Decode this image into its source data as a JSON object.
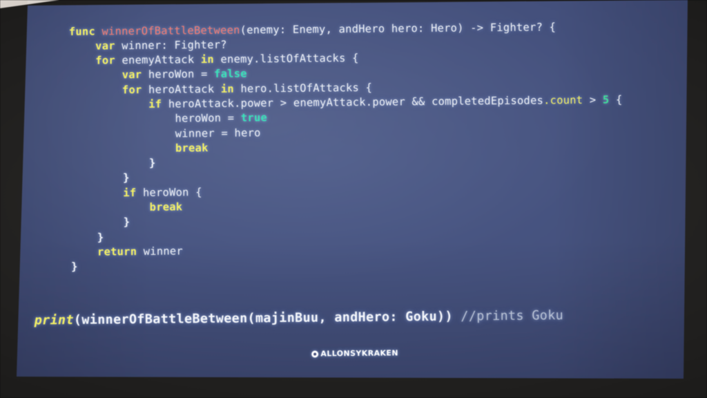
{
  "scene": {
    "type": "photo-of-projector-screen",
    "background_color": "#45507a",
    "bezel_color": "#201f1e",
    "wall_color": "#d2cbc3"
  },
  "code": {
    "language": "Swift",
    "lines": [
      [
        {
          "t": "    ",
          "c": "plain"
        },
        {
          "t": "func ",
          "c": "kw"
        },
        {
          "t": "winnerOfBattleBetween",
          "c": "fnname"
        },
        {
          "t": "(enemy: Enemy, andHero hero: Hero) -> Fighter? {",
          "c": "plain"
        }
      ],
      [
        {
          "t": "        ",
          "c": "plain"
        },
        {
          "t": "var ",
          "c": "kw"
        },
        {
          "t": "winner: Fighter?",
          "c": "plain"
        }
      ],
      [
        {
          "t": "        ",
          "c": "plain"
        },
        {
          "t": "for ",
          "c": "kw"
        },
        {
          "t": "enemyAttack ",
          "c": "plain"
        },
        {
          "t": "in ",
          "c": "kw"
        },
        {
          "t": "enemy.listOfAttacks {",
          "c": "plain"
        }
      ],
      [
        {
          "t": "            ",
          "c": "plain"
        },
        {
          "t": "var ",
          "c": "kw"
        },
        {
          "t": "heroWon = ",
          "c": "plain"
        },
        {
          "t": "false",
          "c": "lit"
        }
      ],
      [
        {
          "t": "            ",
          "c": "plain"
        },
        {
          "t": "for ",
          "c": "kw"
        },
        {
          "t": "heroAttack ",
          "c": "plain"
        },
        {
          "t": "in ",
          "c": "kw"
        },
        {
          "t": "hero.listOfAttacks {",
          "c": "plain"
        }
      ],
      [
        {
          "t": "                ",
          "c": "plain"
        },
        {
          "t": "if ",
          "c": "kw"
        },
        {
          "t": "heroAttack.power > enemyAttack.power && completedEpisodes",
          "c": "plain"
        },
        {
          "t": ".count",
          "c": "prop"
        },
        {
          "t": " > ",
          "c": "plain"
        },
        {
          "t": "5",
          "c": "num"
        },
        {
          "t": " {",
          "c": "plain"
        }
      ],
      [
        {
          "t": "                    ",
          "c": "plain"
        },
        {
          "t": "heroWon = ",
          "c": "plain"
        },
        {
          "t": "true",
          "c": "lit"
        }
      ],
      [
        {
          "t": "                    ",
          "c": "plain"
        },
        {
          "t": "winner = hero",
          "c": "plain"
        }
      ],
      [
        {
          "t": "                    ",
          "c": "plain"
        },
        {
          "t": "break",
          "c": "kw"
        }
      ],
      [
        {
          "t": "                ",
          "c": "plain"
        },
        {
          "t": "}",
          "c": "brace"
        }
      ],
      [
        {
          "t": "            ",
          "c": "plain"
        },
        {
          "t": "}",
          "c": "brace"
        }
      ],
      [
        {
          "t": "            ",
          "c": "plain"
        },
        {
          "t": "if ",
          "c": "kw"
        },
        {
          "t": "heroWon {",
          "c": "plain"
        }
      ],
      [
        {
          "t": "                ",
          "c": "plain"
        },
        {
          "t": "break",
          "c": "kw"
        }
      ],
      [
        {
          "t": "            ",
          "c": "plain"
        },
        {
          "t": "}",
          "c": "brace"
        }
      ],
      [
        {
          "t": "        ",
          "c": "plain"
        },
        {
          "t": "}",
          "c": "brace"
        }
      ],
      [
        {
          "t": "        ",
          "c": "plain"
        },
        {
          "t": "return ",
          "c": "kw"
        },
        {
          "t": "winner",
          "c": "plain"
        }
      ],
      [
        {
          "t": "    ",
          "c": "plain"
        },
        {
          "t": "}",
          "c": "brace"
        }
      ]
    ]
  },
  "print_statement": {
    "keyword": "print",
    "call": "(winnerOfBattleBetween(majinBuu, andHero: Goku))",
    "comment": "//prints Goku"
  },
  "watermark": {
    "handle": "ALLONSYKRAKEN",
    "icon": "at-circle-icon"
  },
  "colors": {
    "keyword": "#f3f06a",
    "function_name": "#ef7d74",
    "literal": "#3fe0b8",
    "number": "#44dd9c",
    "property": "#f3f06a",
    "plain_text": "#eef1f6",
    "comment": "#b9c2d4",
    "slide_background": "#45507a"
  }
}
